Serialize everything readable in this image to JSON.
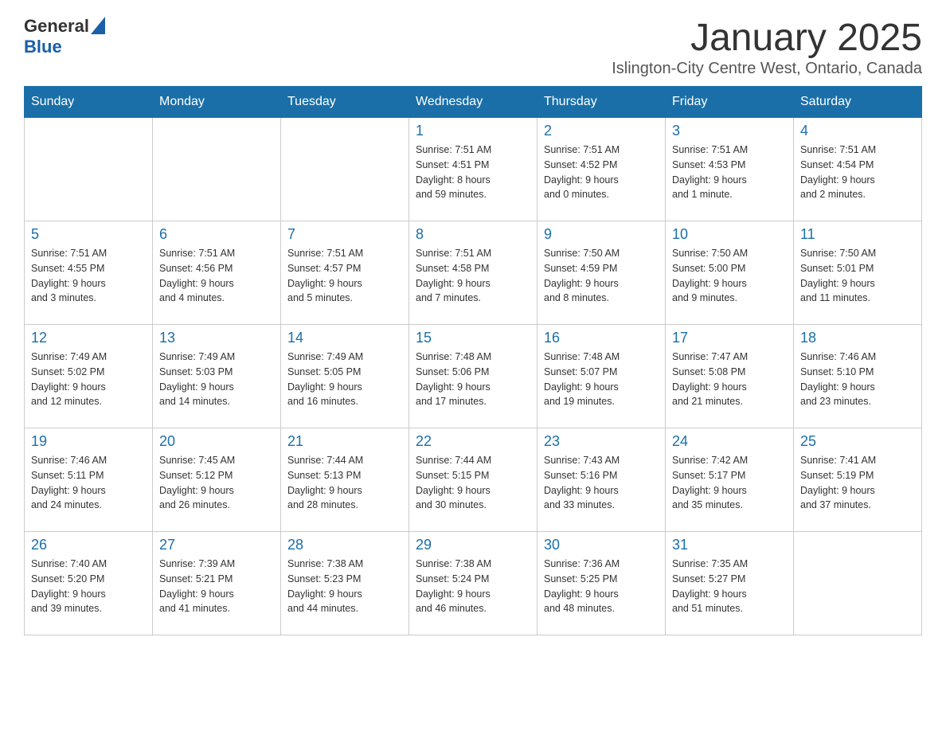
{
  "header": {
    "logo_general": "General",
    "logo_blue": "Blue",
    "title": "January 2025",
    "subtitle": "Islington-City Centre West, Ontario, Canada"
  },
  "weekdays": [
    "Sunday",
    "Monday",
    "Tuesday",
    "Wednesday",
    "Thursday",
    "Friday",
    "Saturday"
  ],
  "weeks": [
    [
      {
        "day": "",
        "info": ""
      },
      {
        "day": "",
        "info": ""
      },
      {
        "day": "",
        "info": ""
      },
      {
        "day": "1",
        "info": "Sunrise: 7:51 AM\nSunset: 4:51 PM\nDaylight: 8 hours\nand 59 minutes."
      },
      {
        "day": "2",
        "info": "Sunrise: 7:51 AM\nSunset: 4:52 PM\nDaylight: 9 hours\nand 0 minutes."
      },
      {
        "day": "3",
        "info": "Sunrise: 7:51 AM\nSunset: 4:53 PM\nDaylight: 9 hours\nand 1 minute."
      },
      {
        "day": "4",
        "info": "Sunrise: 7:51 AM\nSunset: 4:54 PM\nDaylight: 9 hours\nand 2 minutes."
      }
    ],
    [
      {
        "day": "5",
        "info": "Sunrise: 7:51 AM\nSunset: 4:55 PM\nDaylight: 9 hours\nand 3 minutes."
      },
      {
        "day": "6",
        "info": "Sunrise: 7:51 AM\nSunset: 4:56 PM\nDaylight: 9 hours\nand 4 minutes."
      },
      {
        "day": "7",
        "info": "Sunrise: 7:51 AM\nSunset: 4:57 PM\nDaylight: 9 hours\nand 5 minutes."
      },
      {
        "day": "8",
        "info": "Sunrise: 7:51 AM\nSunset: 4:58 PM\nDaylight: 9 hours\nand 7 minutes."
      },
      {
        "day": "9",
        "info": "Sunrise: 7:50 AM\nSunset: 4:59 PM\nDaylight: 9 hours\nand 8 minutes."
      },
      {
        "day": "10",
        "info": "Sunrise: 7:50 AM\nSunset: 5:00 PM\nDaylight: 9 hours\nand 9 minutes."
      },
      {
        "day": "11",
        "info": "Sunrise: 7:50 AM\nSunset: 5:01 PM\nDaylight: 9 hours\nand 11 minutes."
      }
    ],
    [
      {
        "day": "12",
        "info": "Sunrise: 7:49 AM\nSunset: 5:02 PM\nDaylight: 9 hours\nand 12 minutes."
      },
      {
        "day": "13",
        "info": "Sunrise: 7:49 AM\nSunset: 5:03 PM\nDaylight: 9 hours\nand 14 minutes."
      },
      {
        "day": "14",
        "info": "Sunrise: 7:49 AM\nSunset: 5:05 PM\nDaylight: 9 hours\nand 16 minutes."
      },
      {
        "day": "15",
        "info": "Sunrise: 7:48 AM\nSunset: 5:06 PM\nDaylight: 9 hours\nand 17 minutes."
      },
      {
        "day": "16",
        "info": "Sunrise: 7:48 AM\nSunset: 5:07 PM\nDaylight: 9 hours\nand 19 minutes."
      },
      {
        "day": "17",
        "info": "Sunrise: 7:47 AM\nSunset: 5:08 PM\nDaylight: 9 hours\nand 21 minutes."
      },
      {
        "day": "18",
        "info": "Sunrise: 7:46 AM\nSunset: 5:10 PM\nDaylight: 9 hours\nand 23 minutes."
      }
    ],
    [
      {
        "day": "19",
        "info": "Sunrise: 7:46 AM\nSunset: 5:11 PM\nDaylight: 9 hours\nand 24 minutes."
      },
      {
        "day": "20",
        "info": "Sunrise: 7:45 AM\nSunset: 5:12 PM\nDaylight: 9 hours\nand 26 minutes."
      },
      {
        "day": "21",
        "info": "Sunrise: 7:44 AM\nSunset: 5:13 PM\nDaylight: 9 hours\nand 28 minutes."
      },
      {
        "day": "22",
        "info": "Sunrise: 7:44 AM\nSunset: 5:15 PM\nDaylight: 9 hours\nand 30 minutes."
      },
      {
        "day": "23",
        "info": "Sunrise: 7:43 AM\nSunset: 5:16 PM\nDaylight: 9 hours\nand 33 minutes."
      },
      {
        "day": "24",
        "info": "Sunrise: 7:42 AM\nSunset: 5:17 PM\nDaylight: 9 hours\nand 35 minutes."
      },
      {
        "day": "25",
        "info": "Sunrise: 7:41 AM\nSunset: 5:19 PM\nDaylight: 9 hours\nand 37 minutes."
      }
    ],
    [
      {
        "day": "26",
        "info": "Sunrise: 7:40 AM\nSunset: 5:20 PM\nDaylight: 9 hours\nand 39 minutes."
      },
      {
        "day": "27",
        "info": "Sunrise: 7:39 AM\nSunset: 5:21 PM\nDaylight: 9 hours\nand 41 minutes."
      },
      {
        "day": "28",
        "info": "Sunrise: 7:38 AM\nSunset: 5:23 PM\nDaylight: 9 hours\nand 44 minutes."
      },
      {
        "day": "29",
        "info": "Sunrise: 7:38 AM\nSunset: 5:24 PM\nDaylight: 9 hours\nand 46 minutes."
      },
      {
        "day": "30",
        "info": "Sunrise: 7:36 AM\nSunset: 5:25 PM\nDaylight: 9 hours\nand 48 minutes."
      },
      {
        "day": "31",
        "info": "Sunrise: 7:35 AM\nSunset: 5:27 PM\nDaylight: 9 hours\nand 51 minutes."
      },
      {
        "day": "",
        "info": ""
      }
    ]
  ]
}
